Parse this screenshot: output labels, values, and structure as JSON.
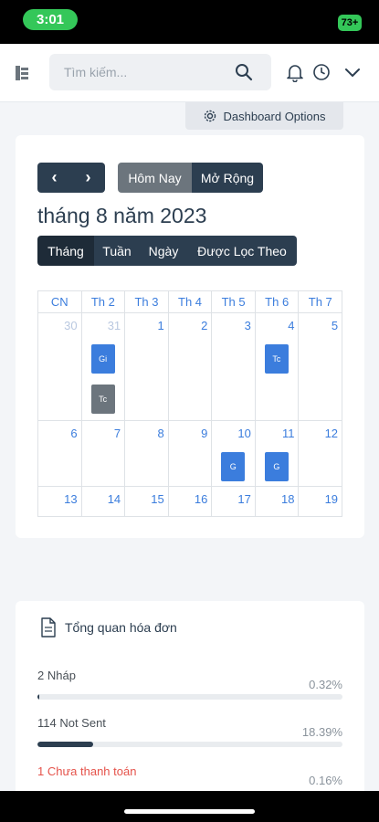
{
  "status": {
    "time": "3:01",
    "battery": "73+"
  },
  "header": {
    "search_placeholder": "Tìm kiếm..."
  },
  "dashboard_options": "Dashboard Options",
  "calendar": {
    "prev": "‹",
    "next": "›",
    "today": "Hôm Nay",
    "expand": "Mở Rộng",
    "month_title": "tháng 8 năm 2023",
    "views": [
      "Tháng",
      "Tuần",
      "Ngày",
      "Được Lọc Theo"
    ],
    "weekdays": [
      "CN",
      "Th 2",
      "Th 3",
      "Th 4",
      "Th 5",
      "Th 6",
      "Th 7"
    ],
    "weeks": [
      [
        "30",
        "31",
        "1",
        "2",
        "3",
        "4",
        "5"
      ],
      [
        "6",
        "7",
        "8",
        "9",
        "10",
        "11",
        "12"
      ],
      [
        "13",
        "14",
        "15",
        "16",
        "17",
        "18",
        "19"
      ]
    ],
    "events": [
      {
        "week": 0,
        "day": 1,
        "slot": 0,
        "label": "Gi",
        "color": "#3b7ddd"
      },
      {
        "week": 0,
        "day": 1,
        "slot": 1,
        "label": "Tc",
        "color": "#6c757d"
      },
      {
        "week": 0,
        "day": 5,
        "slot": 0,
        "label": "Tc",
        "color": "#3b7ddd"
      },
      {
        "week": 1,
        "day": 4,
        "slot": 0,
        "label": "G",
        "color": "#3b7ddd"
      },
      {
        "week": 1,
        "day": 5,
        "slot": 0,
        "label": "G",
        "color": "#3b7ddd"
      }
    ]
  },
  "invoices": {
    "title": "Tổng quan hóa đơn",
    "items": [
      {
        "label": "2 Nháp",
        "percent": "0.32%",
        "fraction": 0.0032
      },
      {
        "label": "114 Not Sent",
        "percent": "18.39%",
        "fraction": 0.1839
      },
      {
        "label": "1 Chưa thanh toán",
        "percent": "0.16%",
        "fraction": 0.0016
      }
    ]
  },
  "colors": {
    "primary": "#2c3e50",
    "accent": "#3b7ddd",
    "danger": "#e5534b",
    "success": "#34c759"
  }
}
